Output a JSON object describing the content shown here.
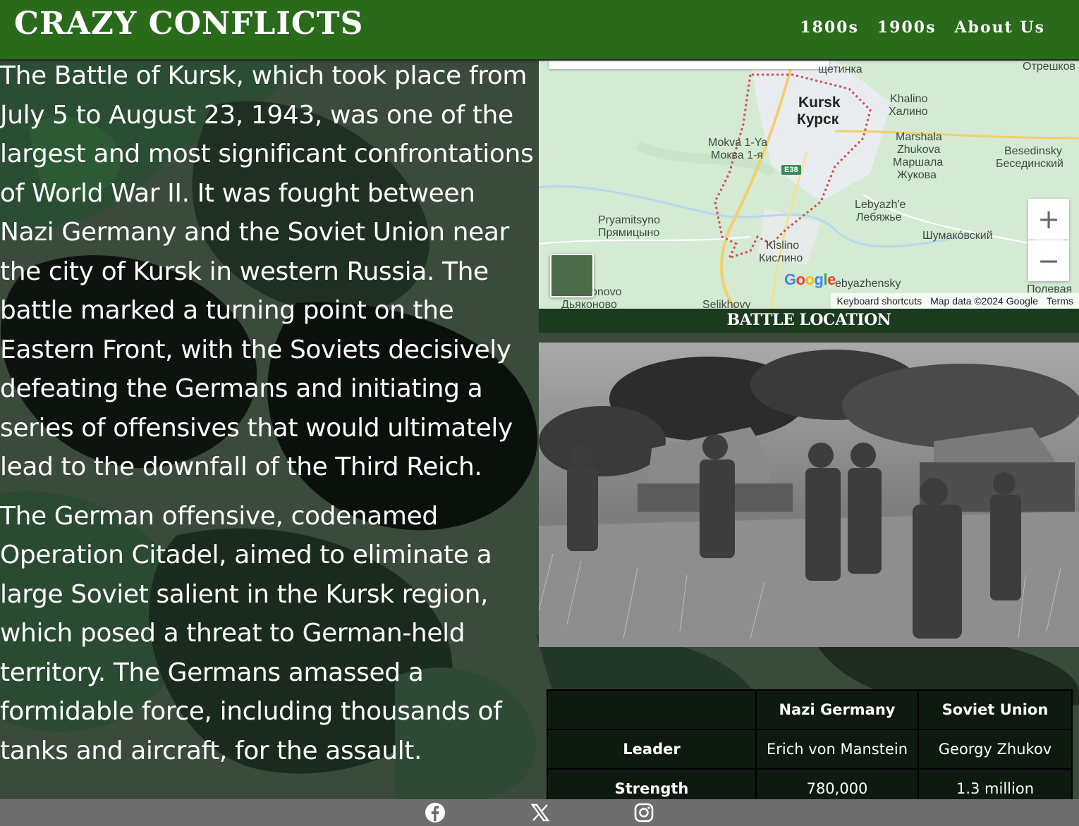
{
  "site": {
    "title": "CRAZY CONFLICTS"
  },
  "nav": {
    "items": [
      "1800s",
      "1900s",
      "About Us"
    ]
  },
  "article": {
    "paragraphs": [
      "The Battle of Kursk, which took place from July 5 to August 23, 1943, was one of the largest and most significant confrontations of World War II. It was fought between Nazi Germany and the Soviet Union near the city of Kursk in western Russia. The battle marked a turning point on the Eastern Front, with the Soviets decisively defeating the Germans and initiating a series of offensives that would ultimately lead to the downfall of the Third Reich.",
      "The German offensive, codenamed Operation Citadel, aimed to eliminate a large Soviet salient in the Kursk region, which posed a threat to German-held territory. The Germans amassed a formidable force, including thousands of tanks and aircraft, for the assault."
    ]
  },
  "map": {
    "caption": "BATTLE LOCATION",
    "labels": {
      "kursk": "Kursk",
      "kursk_ru": "Курск",
      "shchetinka": "щетинка",
      "khalino": "Khalino",
      "khalino_ru": "Халино",
      "marshala_1": "Marshala",
      "marshala_2": "Zhukova",
      "marshala_ru1": "Маршала",
      "marshala_ru2": "Жукова",
      "besedinsky": "Besedinsky",
      "besedinsky_ru": "Бесединский",
      "mokva": "Mokva 1-Ya",
      "mokva_ru": "Моква 1-я",
      "lebyazhe": "Lebyazh'e",
      "lebyazhe_ru": "Лебяжье",
      "pryamitsyno": "Pryamitsyno",
      "pryamitsyno_ru": "Прямицыно",
      "shumakovsky_ru": "Шумако́вский",
      "kislino": "Kislino",
      "kislino_ru": "Кислино",
      "lebyazhensky": "ebyazhensky",
      "dyakonovo": "onovo",
      "dyakonovo_ru": "Дьяконово",
      "selikhovy": "Selikhovy",
      "oreshkov_ru": "Отрешков",
      "polevaya_ru": "Полевая",
      "road": "E38"
    },
    "google_logo": "Google",
    "attribution": {
      "shortcuts": "Keyboard shortcuts",
      "data": "Map data ©2024 Google",
      "terms": "Terms"
    },
    "zoom_in": "+",
    "zoom_out": "−"
  },
  "comparison": {
    "headers": [
      "",
      "Nazi Germany",
      "Soviet Union"
    ],
    "rows": [
      {
        "label": "Leader",
        "germany": "Erich von Manstein",
        "soviet": "Georgy Zhukov"
      },
      {
        "label": "Strength",
        "germany": "780,000",
        "soviet": "1.3 million"
      }
    ]
  },
  "footer": {
    "social": [
      "facebook-icon",
      "x-icon",
      "instagram-icon"
    ]
  },
  "colors": {
    "header": "#2a6a1b",
    "caption_bg": "#1b3a1e",
    "table_bg": "#0e1a10",
    "footer": "#6e6e6e"
  }
}
